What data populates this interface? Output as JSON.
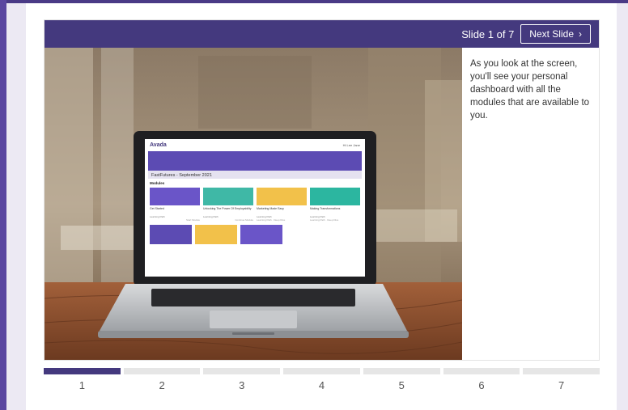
{
  "slider": {
    "counter": "Slide 1 of 7",
    "next_label": "Next Slide",
    "next_icon": "chevron-right-icon",
    "caption": "As you look at the screen, you'll see your personal dashboard with all the modules that are available to you.",
    "current": 1
  },
  "laptop_screen": {
    "logo": "Avada",
    "user_label": "Hi Lee Jane",
    "banner_title": "FastFutures - September 2021",
    "section_label": "Modules",
    "modules": [
      {
        "title": "Get Started",
        "sub": "Learning Path",
        "link": "Start Module"
      },
      {
        "title": "Unlocking The Power Of Employability",
        "sub": "Learning Path",
        "link": "Continue Module"
      },
      {
        "title": "Marketing Made Easy",
        "sub": "Learning Path",
        "link": "Learning Path · Deep Dive"
      },
      {
        "title": "Making Transformations",
        "sub": "Learning Path",
        "link": "Learning Path · Deep Dive"
      }
    ]
  },
  "progress": {
    "steps": [
      "1",
      "2",
      "3",
      "4",
      "5",
      "6",
      "7"
    ]
  },
  "colors": {
    "accent": "#44397e",
    "rail": "#5a46a0",
    "inactive_segment": "#e6e6e6"
  }
}
